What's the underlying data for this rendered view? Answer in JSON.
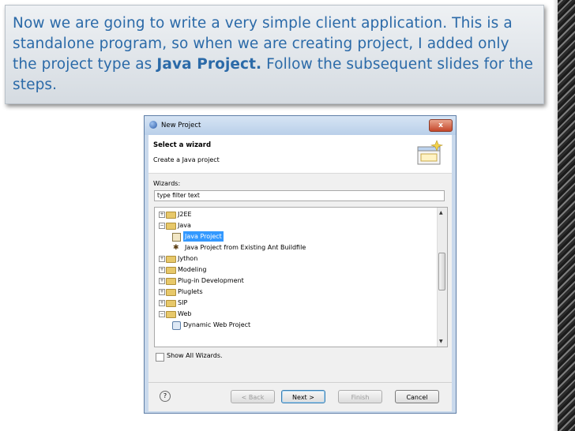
{
  "caption": {
    "before": "Now we are going to write a very simple client application. This is a standalone program, so when we are creating project,  I added only the project type as ",
    "bold": "Java Project.",
    "after": " Follow the subsequent slides for the steps."
  },
  "dialog": {
    "title": "New Project",
    "close_label": "x",
    "header_title": "Select a wizard",
    "header_subtitle": "Create a Java project",
    "wizards_label": "Wizards:",
    "filter_value": "type filter text",
    "tree": [
      {
        "label": "J2EE",
        "toggle": "+",
        "icon": "folder-icon"
      },
      {
        "label": "Java",
        "toggle": "−",
        "icon": "folder-icon"
      },
      {
        "label": "Java Project",
        "icon": "java-project-icon",
        "selected": true
      },
      {
        "label": "Java Project from Existing Ant Buildfile",
        "icon": "ant-icon"
      },
      {
        "label": "Jython",
        "toggle": "+",
        "icon": "folder-icon"
      },
      {
        "label": "Modeling",
        "toggle": "+",
        "icon": "folder-icon"
      },
      {
        "label": "Plug-in Development",
        "toggle": "+",
        "icon": "folder-icon"
      },
      {
        "label": "Pluglets",
        "toggle": "+",
        "icon": "folder-icon"
      },
      {
        "label": "SIP",
        "toggle": "+",
        "icon": "folder-icon"
      },
      {
        "label": "Web",
        "toggle": "−",
        "icon": "folder-icon"
      },
      {
        "label": "Dynamic Web Project",
        "icon": "web-project-icon"
      }
    ],
    "show_all_label": "Show All Wizards.",
    "help_label": "?",
    "buttons": {
      "back": "< Back",
      "next": "Next >",
      "finish": "Finish",
      "cancel": "Cancel"
    }
  },
  "colors": {
    "caption_text": "#2b6aa8",
    "selection": "#3399ff"
  }
}
